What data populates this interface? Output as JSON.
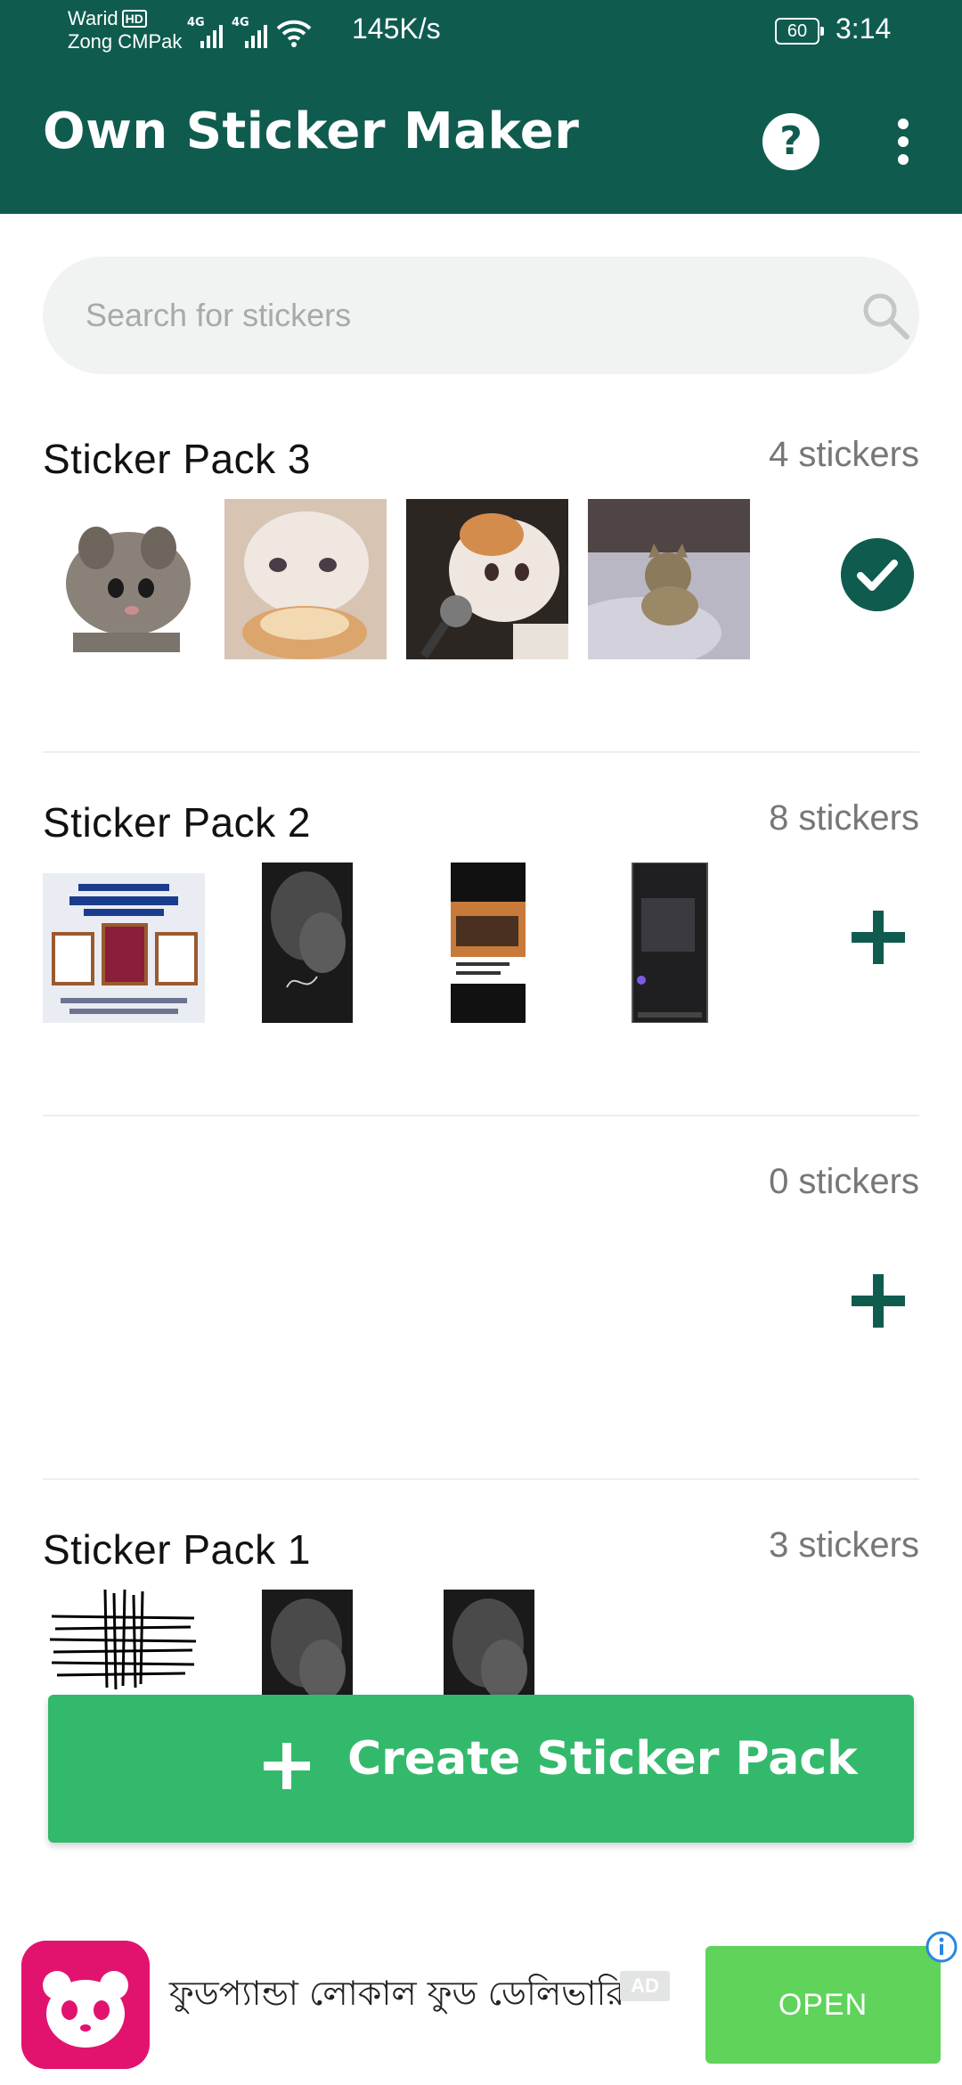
{
  "status_bar": {
    "carrier_1": "Warid",
    "hd_badge": "HD",
    "carrier_2": "Zong CMPak",
    "network_1": "4G",
    "network_2": "4G",
    "net_speed": "145K/s",
    "battery": "60",
    "time": "3:14"
  },
  "app_bar": {
    "title": "Own Sticker Maker",
    "help_icon": "help-circle-icon",
    "menu_icon": "more-vertical-icon"
  },
  "search": {
    "placeholder": "Search for stickers",
    "value": ""
  },
  "packs": [
    {
      "title": "Sticker Pack 3",
      "count": "4 stickers",
      "thumbnails": [
        "kitten-sticker",
        "crying-cat-bread-sticker",
        "crying-cat-microphone-sticker",
        "cat-on-bed-sticker"
      ],
      "action_icon": "check-circle-icon"
    },
    {
      "title": "Sticker Pack 2",
      "count": "8 stickers",
      "thumbnails": [
        "bank-awards-sticker",
        "dark-smoke-sticker",
        "instagram-screenshot-sticker",
        "chat-screenshot-sticker"
      ],
      "action_icon": "plus-icon"
    },
    {
      "title": "",
      "count": "0 stickers",
      "thumbnails": [],
      "action_icon": "plus-icon"
    },
    {
      "title": "Sticker Pack 1",
      "count": "3 stickers",
      "thumbnails": [
        "scribble-sticker",
        "dark-smoke-sticker",
        "dark-smoke-sticker"
      ],
      "action_icon": "plus-icon"
    }
  ],
  "create_button": {
    "label": "Create Sticker Pack",
    "icon": "plus-icon"
  },
  "ad": {
    "text": "ফুডপ্যান্ডা লোকাল ফুড ডেলিভারি",
    "badge": "AD",
    "cta": "OPEN",
    "logo_icon": "foodpanda-logo-icon",
    "info_icon": "info-icon"
  },
  "colors": {
    "primary": "#0f5c4f",
    "create_button": "#33b96b",
    "ad_cta": "#5fd35a",
    "ad_logo": "#e2136e",
    "search_bg": "#f1f3f2"
  }
}
